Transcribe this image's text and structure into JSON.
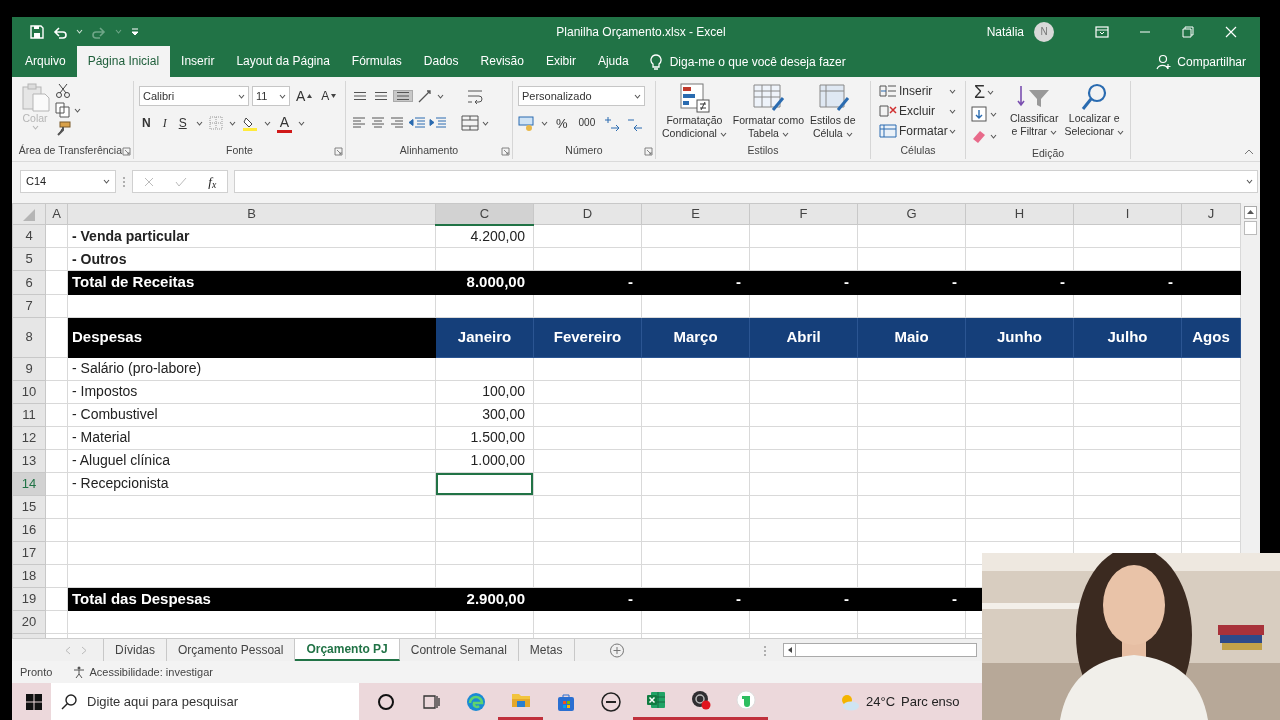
{
  "title_bar": {
    "title": "Planilha Orçamento.xlsx  -  Excel",
    "user": "Natália",
    "avatar": "N",
    "redo_disabled": true
  },
  "menu": {
    "tabs": [
      {
        "label": "Arquivo",
        "selected": false
      },
      {
        "label": "Página Inicial",
        "selected": true
      },
      {
        "label": "Inserir",
        "selected": false
      },
      {
        "label": "Layout da Página",
        "selected": false
      },
      {
        "label": "Fórmulas",
        "selected": false
      },
      {
        "label": "Dados",
        "selected": false
      },
      {
        "label": "Revisão",
        "selected": false
      },
      {
        "label": "Exibir",
        "selected": false
      },
      {
        "label": "Ajuda",
        "selected": false
      }
    ],
    "tell_me": "Diga-me o que você deseja fazer",
    "share": "Compartilhar"
  },
  "ribbon": {
    "clipboard": {
      "label": "Área de Transferência",
      "paste": {
        "label": "Colar",
        "disabled": true
      }
    },
    "font": {
      "label": "Fonte",
      "font_name": "Calibri",
      "font_size": "11",
      "grow": "A",
      "shrink": "A",
      "bold": "N",
      "italic": "I",
      "underline": "S",
      "font_color": "A"
    },
    "alignment": {
      "label": "Alinhamento",
      "vertical_options": [
        {
          "selected": false
        },
        {
          "selected": false
        },
        {
          "selected": true
        }
      ]
    },
    "number": {
      "label": "Número",
      "format": "Personalizado",
      "percent": "%",
      "thousands": "000"
    },
    "styles": {
      "label": "Estilos",
      "buttons": [
        {
          "lines": [
            "Formatação",
            "Condicional"
          ]
        },
        {
          "lines": [
            "Formatar como",
            "Tabela"
          ]
        },
        {
          "lines": [
            "Estilos de",
            "Célula"
          ]
        }
      ]
    },
    "cells": {
      "label": "Células",
      "buttons": [
        "Inserir",
        "Excluir",
        "Formatar"
      ]
    },
    "editing": {
      "label": "Edição",
      "sum": "Σ",
      "buttons": [
        {
          "lines": [
            "Classificar",
            "e Filtrar"
          ]
        },
        {
          "lines": [
            "Localizar e",
            "Selecionar"
          ]
        }
      ]
    }
  },
  "formula_bar": {
    "name_box": "C14",
    "fx": "f$_{x}$"
  },
  "sheet": {
    "columns": [
      {
        "label": "A",
        "selected": false
      },
      {
        "label": "B",
        "selected": false
      },
      {
        "label": "C",
        "selected": true
      },
      {
        "label": "D",
        "selected": false
      },
      {
        "label": "E",
        "selected": false
      },
      {
        "label": "F",
        "selected": false
      },
      {
        "label": "G",
        "selected": false
      },
      {
        "label": "H",
        "selected": false
      },
      {
        "label": "I",
        "selected": false
      },
      {
        "label": "J",
        "selected": false
      }
    ],
    "rows": [
      {
        "number": "4",
        "kind": "bold",
        "selected": false,
        "label": "- Venda particular",
        "values": [
          "4.200,00"
        ]
      },
      {
        "number": "5",
        "kind": "bold",
        "selected": false,
        "label": "- Outros"
      },
      {
        "number": "6",
        "kind": "total",
        "selected": false,
        "label": "Total de Receitas",
        "values": [
          "8.000,00",
          "-",
          "-",
          "-",
          "-",
          "-",
          "-"
        ]
      },
      {
        "number": "7",
        "kind": "blank",
        "selected": false
      },
      {
        "number": "8",
        "kind": "header",
        "selected": false,
        "label": "Despesas",
        "values": [
          "Janeiro",
          "Fevereiro",
          "Março",
          "Abril",
          "Maio",
          "Junho",
          "Julho",
          "Agos"
        ]
      },
      {
        "number": "9",
        "kind": "item",
        "selected": false,
        "label": "- Salário (pro-labore)"
      },
      {
        "number": "10",
        "kind": "item",
        "selected": false,
        "label": "- Impostos",
        "values": [
          "100,00"
        ]
      },
      {
        "number": "11",
        "kind": "item",
        "selected": false,
        "label": "- Combustivel",
        "values": [
          "300,00"
        ]
      },
      {
        "number": "12",
        "kind": "item",
        "selected": false,
        "label": "- Material",
        "values": [
          "1.500,00"
        ]
      },
      {
        "number": "13",
        "kind": "item",
        "selected": false,
        "label": "- Aluguel clínica",
        "values": [
          "1.000,00"
        ]
      },
      {
        "number": "14",
        "kind": "item",
        "selected": true,
        "label": "- Recepcionista"
      },
      {
        "number": "15",
        "kind": "blank",
        "selected": false
      },
      {
        "number": "16",
        "kind": "blank",
        "selected": false
      },
      {
        "number": "17",
        "kind": "blank",
        "selected": false
      },
      {
        "number": "18",
        "kind": "blank",
        "selected": false
      },
      {
        "number": "19",
        "kind": "total",
        "selected": false,
        "label": "Total das Despesas",
        "values": [
          "2.900,00",
          "-",
          "-",
          "-",
          "-"
        ]
      },
      {
        "number": "20",
        "kind": "blank",
        "selected": false
      }
    ]
  },
  "sheet_tabs": [
    {
      "label": "Dívidas",
      "selected": false
    },
    {
      "label": "Orçamento Pessoal",
      "selected": false
    },
    {
      "label": "Orçamento PJ",
      "selected": true
    },
    {
      "label": "Controle Semanal",
      "selected": false
    },
    {
      "label": "Metas",
      "selected": false
    }
  ],
  "status_bar": {
    "status": "Pronto",
    "accessibility": "Acessibilidade: investigar"
  },
  "taskbar": {
    "search_placeholder": "Digite aqui para pesquisar",
    "apps": [
      {
        "kind": "cortana",
        "open": false
      },
      {
        "kind": "taskview",
        "open": false
      },
      {
        "kind": "edge",
        "open": false
      },
      {
        "kind": "explorer",
        "open": true
      },
      {
        "kind": "store",
        "open": false
      },
      {
        "kind": "dell",
        "open": false
      },
      {
        "kind": "excel",
        "open": true
      },
      {
        "kind": "recorder",
        "open": true
      },
      {
        "kind": "evernote",
        "open": true
      }
    ],
    "weather": {
      "temperature": "24°C",
      "condition": "Parc enso"
    }
  }
}
